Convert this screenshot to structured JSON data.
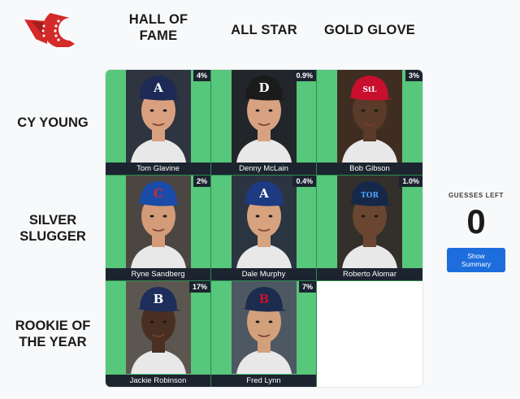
{
  "columns": [
    {
      "label_line1": "HALL OF",
      "label_line2": "FAME"
    },
    {
      "label_line1": "ALL STAR",
      "label_line2": ""
    },
    {
      "label_line1": "GOLD GLOVE",
      "label_line2": ""
    }
  ],
  "rows": [
    {
      "label_line1": "CY YOUNG",
      "label_line2": ""
    },
    {
      "label_line1": "SILVER",
      "label_line2": "SLUGGER"
    },
    {
      "label_line1": "ROOKIE OF",
      "label_line2": "THE YEAR"
    }
  ],
  "cells": [
    {
      "player": "Tom Glavine",
      "pct": "4%",
      "cap_color": "#1d2a55",
      "cap_logo": "A",
      "logo_color": "#ffffff",
      "skin": "#d9a07f",
      "bg": "#2e3440"
    },
    {
      "player": "Denny McLain",
      "pct": "0.9%",
      "cap_color": "#1b1b1b",
      "cap_logo": "D",
      "logo_color": "#ffffff",
      "skin": "#d8a282",
      "bg": "#22262b"
    },
    {
      "player": "Bob Gibson",
      "pct": "3%",
      "cap_color": "#c8102e",
      "cap_logo": "StL",
      "logo_color": "#ffffff",
      "skin": "#5a3a28",
      "bg": "#3f2d22"
    },
    {
      "player": "Ryne Sandberg",
      "pct": "2%",
      "cap_color": "#1b4ba8",
      "cap_logo": "C",
      "logo_color": "#d62828",
      "skin": "#d39b78",
      "bg": "#4b4642"
    },
    {
      "player": "Dale Murphy",
      "pct": "0.4%",
      "cap_color": "#1d3a82",
      "cap_logo": "A",
      "logo_color": "#ffffff",
      "skin": "#d7a27e",
      "bg": "#2b3542"
    },
    {
      "player": "Roberto Alomar",
      "pct": "1.0%",
      "cap_color": "#15284a",
      "cap_logo": "TOR",
      "logo_color": "#4ea3ff",
      "skin": "#6a4631",
      "bg": "#33302c"
    },
    {
      "player": "Jackie Robinson",
      "pct": "17%",
      "cap_color": "#1d2e5a",
      "cap_logo": "B",
      "logo_color": "#ffffff",
      "skin": "#4a3022",
      "bg": "#5b5650"
    },
    {
      "player": "Fred Lynn",
      "pct": "7%",
      "cap_color": "#1c2c4e",
      "cap_logo": "B",
      "logo_color": "#c8102e",
      "skin": "#d3a07c",
      "bg": "#4e5862"
    },
    null
  ],
  "sidebar": {
    "guesses_label": "GUESSES LEFT",
    "guesses_count": "0",
    "summary_button": "Show Summary"
  },
  "colors": {
    "correct_cell": "#57c77b",
    "name_bar": "#1c2430",
    "button": "#1e6ddd",
    "logo_red": "#d42a2a"
  }
}
